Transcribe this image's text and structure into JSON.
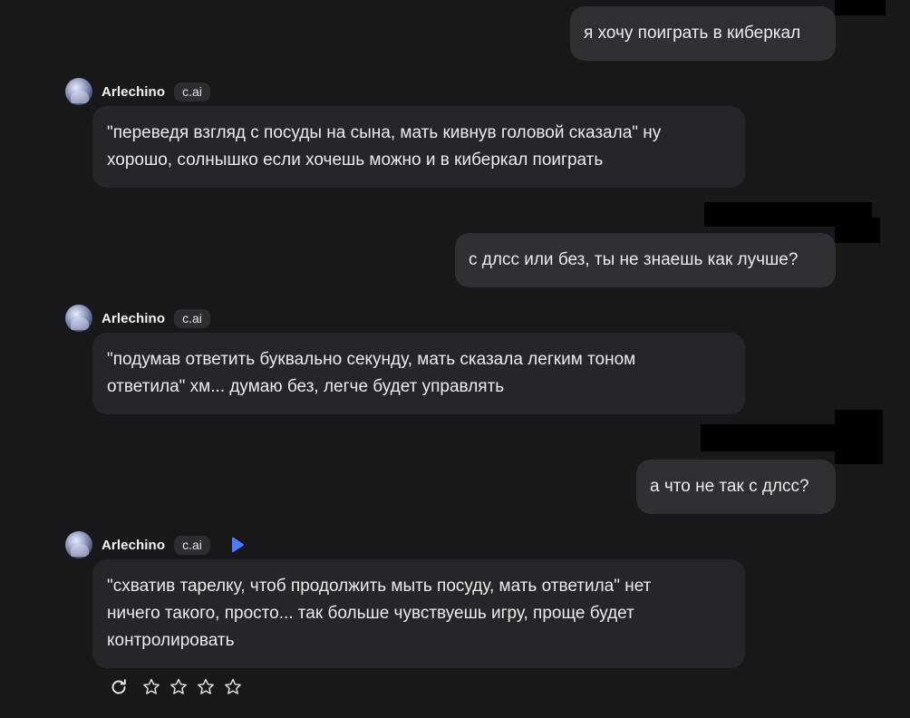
{
  "conversation": {
    "messages": [
      {
        "role": "user",
        "text": "я хочу поиграть в киберкал"
      },
      {
        "role": "bot",
        "name": "Arlechino",
        "badge": "c.ai",
        "lines": [
          "\"переведя взгляд с посуды на сына, мать кивнув головой сказала\" ну",
          "хорошо, солнышко если хочешь можно и в киберкал поиграть"
        ]
      },
      {
        "role": "user",
        "text": "с длсс или без, ты не знаешь как лучше?"
      },
      {
        "role": "bot",
        "name": "Arlechino",
        "badge": "c.ai",
        "lines": [
          "\"подумав ответить буквально секунду, мать сказала легким тоном",
          "ответила\" хм... думаю без, легче будет управлять"
        ]
      },
      {
        "role": "user",
        "text": "а что не так с длсс?"
      },
      {
        "role": "bot",
        "name": "Arlechino",
        "badge": "c.ai",
        "lines": [
          "\"схватив тарелку, чтоб продолжить мыть посуду, мать ответила\" нет",
          "ничего такого, просто... так больше чувствуешь игру, проще будет",
          "контролировать"
        ]
      }
    ]
  },
  "actions": {
    "icons": [
      "refresh-icon",
      "star-icon",
      "star-icon",
      "star-icon",
      "star-icon"
    ],
    "rating": 0
  },
  "icons": {
    "avatar": "avatar",
    "play": "play-icon"
  },
  "colors": {
    "background": "#18181b",
    "user_bubble": "#303034",
    "bot_bubble": "#26262a",
    "badge": "#2d2d31",
    "play_accent": "#4f7cff",
    "text": "#ececee"
  }
}
